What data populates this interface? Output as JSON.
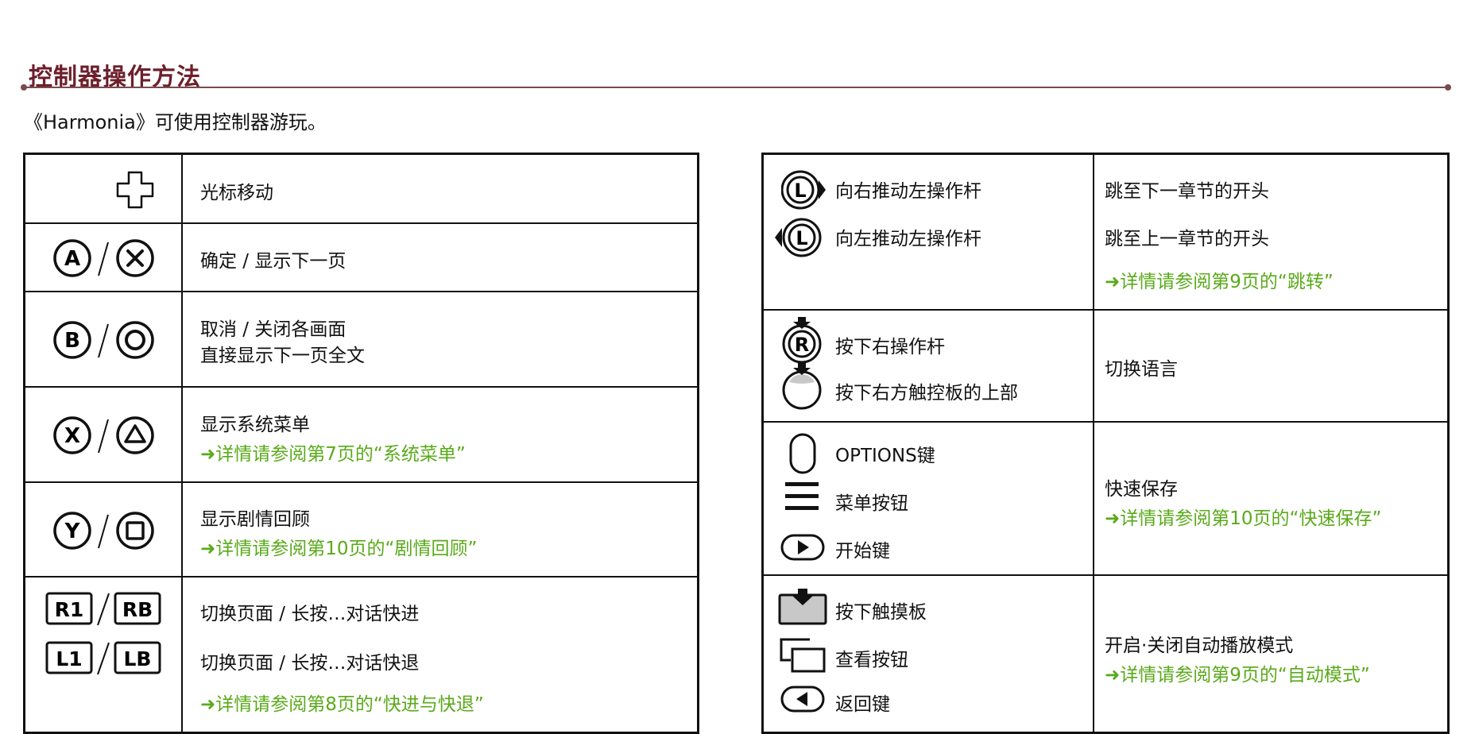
{
  "title": "控制器操作方法",
  "intro": "《Harmonia》可使用控制器游玩。",
  "colors": {
    "title": "#6d1f2b",
    "rule": "#7a4a4f",
    "link": "#5aaa1a"
  },
  "left_table": [
    {
      "icons": [
        "dpad-icon"
      ],
      "lines": [
        "光标移动"
      ]
    },
    {
      "icons": [
        "a-button-icon",
        "cross-button-icon"
      ],
      "lines": [
        "确定 / 显示下一页"
      ]
    },
    {
      "icons": [
        "b-button-icon",
        "circle-button-icon"
      ],
      "lines": [
        "取消 / 关闭各画面",
        "直接显示下一页全文"
      ]
    },
    {
      "icons": [
        "x-button-icon",
        "triangle-button-icon"
      ],
      "lines": [
        "显示系统菜单"
      ],
      "link": "➜详情请参阅第7页的“系统菜单”"
    },
    {
      "icons": [
        "y-button-icon",
        "square-button-icon"
      ],
      "lines": [
        "显示剧情回顾"
      ],
      "link": "➜详情请参阅第10页的“剧情回顾”"
    },
    {
      "icons": [
        "r1-button-icon",
        "rb-button-icon",
        "l1-button-icon",
        "lb-button-icon"
      ],
      "lines": [
        "切换页面 / 长按…对话快进",
        "切换页面 / 长按…对话快退"
      ],
      "link": "➜详情请参阅第8页的“快进与快退”"
    }
  ],
  "right_table": [
    {
      "controls": [
        {
          "icon": "left-stick-right-icon",
          "label": "向右推动左操作杆"
        },
        {
          "icon": "left-stick-left-icon",
          "label": "向左推动左操作杆"
        }
      ],
      "lines": [
        "跳至下一章节的开头",
        "跳至上一章节的开头"
      ],
      "link": "➜详情请参阅第9页的“跳转”"
    },
    {
      "controls": [
        {
          "icon": "right-stick-press-icon",
          "label": "按下右操作杆"
        },
        {
          "icon": "touchpad-top-press-icon",
          "label": "按下右方触控板的上部"
        }
      ],
      "lines": [
        "切换语言"
      ]
    },
    {
      "controls": [
        {
          "icon": "options-button-icon",
          "label": "OPTIONS键"
        },
        {
          "icon": "menu-button-icon",
          "label": "菜单按钮"
        },
        {
          "icon": "start-button-icon",
          "label": "开始键"
        }
      ],
      "lines": [
        "快速保存"
      ],
      "link": "➜详情请参阅第10页的“快速保存”"
    },
    {
      "controls": [
        {
          "icon": "touchpad-press-icon",
          "label": "按下触摸板"
        },
        {
          "icon": "view-button-icon",
          "label": "查看按钮"
        },
        {
          "icon": "back-button-icon",
          "label": "返回键"
        }
      ],
      "lines": [
        "开启·关闭自动播放模式"
      ],
      "link": "➜详情请参阅第9页的“自动模式”"
    }
  ],
  "letters": {
    "a": "A",
    "b": "B",
    "x": "X",
    "y": "Y",
    "r1": "R1",
    "rb": "RB",
    "l1": "L1",
    "lb": "LB",
    "l": "L",
    "r": "R"
  }
}
